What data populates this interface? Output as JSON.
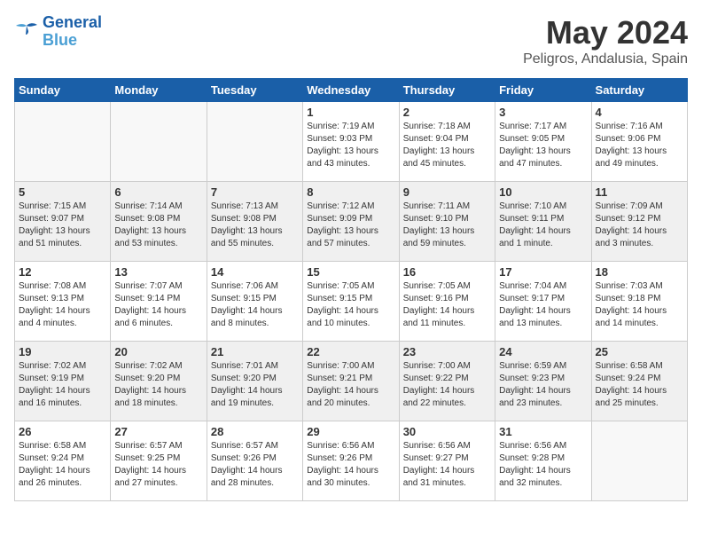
{
  "header": {
    "logo": {
      "line1": "General",
      "line2": "Blue"
    },
    "title": "May 2024",
    "location": "Peligros, Andalusia, Spain"
  },
  "weekdays": [
    "Sunday",
    "Monday",
    "Tuesday",
    "Wednesday",
    "Thursday",
    "Friday",
    "Saturday"
  ],
  "weeks": [
    [
      {
        "day": "",
        "info": ""
      },
      {
        "day": "",
        "info": ""
      },
      {
        "day": "",
        "info": ""
      },
      {
        "day": "1",
        "info": "Sunrise: 7:19 AM\nSunset: 9:03 PM\nDaylight: 13 hours\nand 43 minutes."
      },
      {
        "day": "2",
        "info": "Sunrise: 7:18 AM\nSunset: 9:04 PM\nDaylight: 13 hours\nand 45 minutes."
      },
      {
        "day": "3",
        "info": "Sunrise: 7:17 AM\nSunset: 9:05 PM\nDaylight: 13 hours\nand 47 minutes."
      },
      {
        "day": "4",
        "info": "Sunrise: 7:16 AM\nSunset: 9:06 PM\nDaylight: 13 hours\nand 49 minutes."
      }
    ],
    [
      {
        "day": "5",
        "info": "Sunrise: 7:15 AM\nSunset: 9:07 PM\nDaylight: 13 hours\nand 51 minutes."
      },
      {
        "day": "6",
        "info": "Sunrise: 7:14 AM\nSunset: 9:08 PM\nDaylight: 13 hours\nand 53 minutes."
      },
      {
        "day": "7",
        "info": "Sunrise: 7:13 AM\nSunset: 9:08 PM\nDaylight: 13 hours\nand 55 minutes."
      },
      {
        "day": "8",
        "info": "Sunrise: 7:12 AM\nSunset: 9:09 PM\nDaylight: 13 hours\nand 57 minutes."
      },
      {
        "day": "9",
        "info": "Sunrise: 7:11 AM\nSunset: 9:10 PM\nDaylight: 13 hours\nand 59 minutes."
      },
      {
        "day": "10",
        "info": "Sunrise: 7:10 AM\nSunset: 9:11 PM\nDaylight: 14 hours\nand 1 minute."
      },
      {
        "day": "11",
        "info": "Sunrise: 7:09 AM\nSunset: 9:12 PM\nDaylight: 14 hours\nand 3 minutes."
      }
    ],
    [
      {
        "day": "12",
        "info": "Sunrise: 7:08 AM\nSunset: 9:13 PM\nDaylight: 14 hours\nand 4 minutes."
      },
      {
        "day": "13",
        "info": "Sunrise: 7:07 AM\nSunset: 9:14 PM\nDaylight: 14 hours\nand 6 minutes."
      },
      {
        "day": "14",
        "info": "Sunrise: 7:06 AM\nSunset: 9:15 PM\nDaylight: 14 hours\nand 8 minutes."
      },
      {
        "day": "15",
        "info": "Sunrise: 7:05 AM\nSunset: 9:15 PM\nDaylight: 14 hours\nand 10 minutes."
      },
      {
        "day": "16",
        "info": "Sunrise: 7:05 AM\nSunset: 9:16 PM\nDaylight: 14 hours\nand 11 minutes."
      },
      {
        "day": "17",
        "info": "Sunrise: 7:04 AM\nSunset: 9:17 PM\nDaylight: 14 hours\nand 13 minutes."
      },
      {
        "day": "18",
        "info": "Sunrise: 7:03 AM\nSunset: 9:18 PM\nDaylight: 14 hours\nand 14 minutes."
      }
    ],
    [
      {
        "day": "19",
        "info": "Sunrise: 7:02 AM\nSunset: 9:19 PM\nDaylight: 14 hours\nand 16 minutes."
      },
      {
        "day": "20",
        "info": "Sunrise: 7:02 AM\nSunset: 9:20 PM\nDaylight: 14 hours\nand 18 minutes."
      },
      {
        "day": "21",
        "info": "Sunrise: 7:01 AM\nSunset: 9:20 PM\nDaylight: 14 hours\nand 19 minutes."
      },
      {
        "day": "22",
        "info": "Sunrise: 7:00 AM\nSunset: 9:21 PM\nDaylight: 14 hours\nand 20 minutes."
      },
      {
        "day": "23",
        "info": "Sunrise: 7:00 AM\nSunset: 9:22 PM\nDaylight: 14 hours\nand 22 minutes."
      },
      {
        "day": "24",
        "info": "Sunrise: 6:59 AM\nSunset: 9:23 PM\nDaylight: 14 hours\nand 23 minutes."
      },
      {
        "day": "25",
        "info": "Sunrise: 6:58 AM\nSunset: 9:24 PM\nDaylight: 14 hours\nand 25 minutes."
      }
    ],
    [
      {
        "day": "26",
        "info": "Sunrise: 6:58 AM\nSunset: 9:24 PM\nDaylight: 14 hours\nand 26 minutes."
      },
      {
        "day": "27",
        "info": "Sunrise: 6:57 AM\nSunset: 9:25 PM\nDaylight: 14 hours\nand 27 minutes."
      },
      {
        "day": "28",
        "info": "Sunrise: 6:57 AM\nSunset: 9:26 PM\nDaylight: 14 hours\nand 28 minutes."
      },
      {
        "day": "29",
        "info": "Sunrise: 6:56 AM\nSunset: 9:26 PM\nDaylight: 14 hours\nand 30 minutes."
      },
      {
        "day": "30",
        "info": "Sunrise: 6:56 AM\nSunset: 9:27 PM\nDaylight: 14 hours\nand 31 minutes."
      },
      {
        "day": "31",
        "info": "Sunrise: 6:56 AM\nSunset: 9:28 PM\nDaylight: 14 hours\nand 32 minutes."
      },
      {
        "day": "",
        "info": ""
      }
    ]
  ]
}
